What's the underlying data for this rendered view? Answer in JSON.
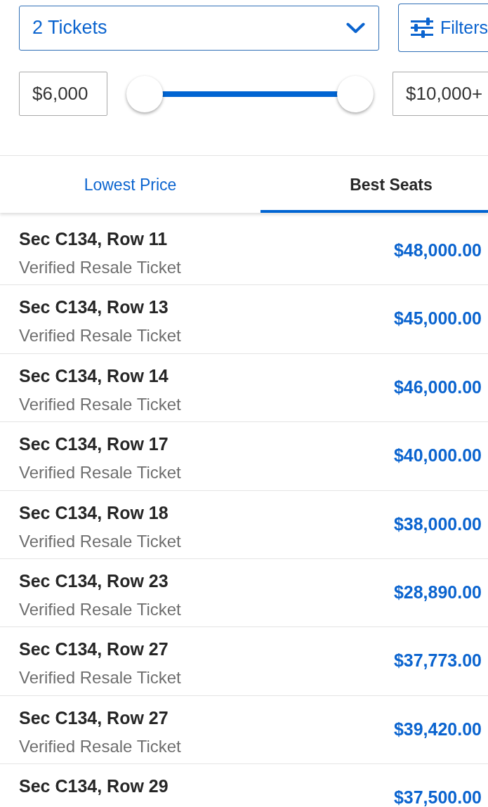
{
  "ticket_quantity": {
    "value": "2 Tickets"
  },
  "filters_button": {
    "label": "Filters"
  },
  "price_range": {
    "min": "$6,000",
    "max": "$10,000+",
    "thumbs": [
      {
        "level": 0
      },
      {
        "level": 1
      }
    ]
  },
  "tabs": [
    {
      "label": "Lowest Price",
      "selected": false
    },
    {
      "label": "Best Seats",
      "selected": true
    }
  ],
  "listings": [
    {
      "seat": "Sec C134, Row 11",
      "ticket_type": "Verified Resale Ticket",
      "price": "$48,000.00"
    },
    {
      "seat": "Sec C134, Row 13",
      "ticket_type": "Verified Resale Ticket",
      "price": "$45,000.00"
    },
    {
      "seat": "Sec C134, Row 14",
      "ticket_type": "Verified Resale Ticket",
      "price": "$46,000.00"
    },
    {
      "seat": "Sec C134, Row 17",
      "ticket_type": "Verified Resale Ticket",
      "price": "$40,000.00"
    },
    {
      "seat": "Sec C134, Row 18",
      "ticket_type": "Verified Resale Ticket",
      "price": "$38,000.00"
    },
    {
      "seat": "Sec C134, Row 23",
      "ticket_type": "Verified Resale Ticket",
      "price": "$28,890.00"
    },
    {
      "seat": "Sec C134, Row 27",
      "ticket_type": "Verified Resale Ticket",
      "price": "$37,773.00"
    },
    {
      "seat": "Sec C134, Row 27",
      "ticket_type": "Verified Resale Ticket",
      "price": "$39,420.00"
    },
    {
      "seat": "Sec C134, Row 29",
      "price": "$37,500.00"
    }
  ]
}
